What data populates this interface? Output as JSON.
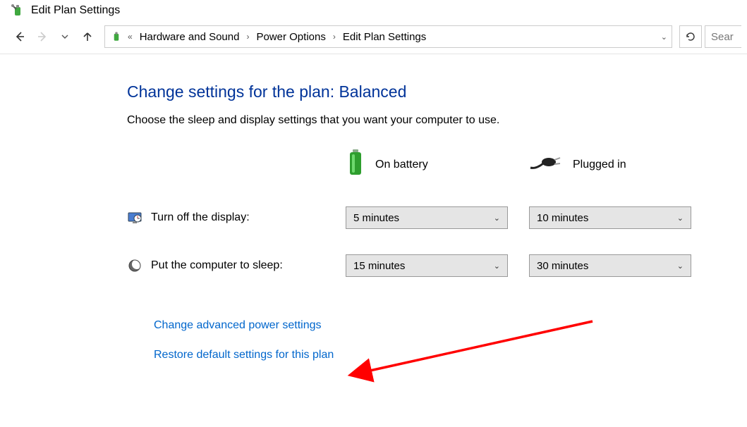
{
  "window": {
    "title": "Edit Plan Settings"
  },
  "breadcrumb": {
    "items": [
      "Hardware and Sound",
      "Power Options",
      "Edit Plan Settings"
    ]
  },
  "search": {
    "placeholder": "Sear"
  },
  "page": {
    "heading": "Change settings for the plan: Balanced",
    "subtext": "Choose the sleep and display settings that you want your computer to use."
  },
  "columns": {
    "battery": "On battery",
    "plugged": "Plugged in"
  },
  "rows": {
    "display": {
      "label": "Turn off the display:",
      "battery": "5 minutes",
      "plugged": "10 minutes"
    },
    "sleep": {
      "label": "Put the computer to sleep:",
      "battery": "15 minutes",
      "plugged": "30 minutes"
    }
  },
  "links": {
    "advanced": "Change advanced power settings",
    "restore": "Restore default settings for this plan"
  }
}
